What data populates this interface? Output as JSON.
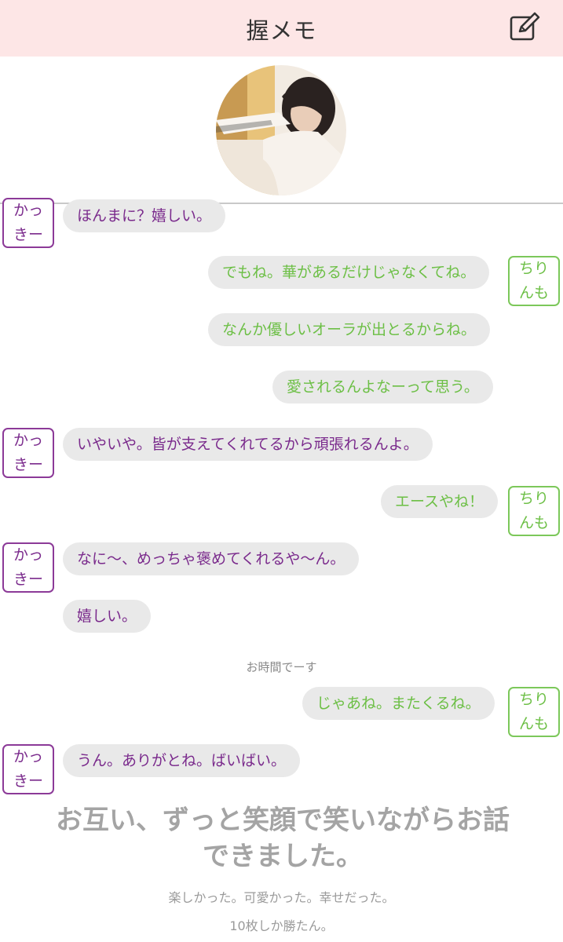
{
  "header": {
    "title": "握メモ",
    "edit_icon": "compose-icon"
  },
  "profile": {
    "avatar_description": "profile-photo"
  },
  "names": {
    "left": "かっきー",
    "right": "ちりんも"
  },
  "messages": [
    {
      "side": "left",
      "text": "ほんまに？嬉しい。"
    },
    {
      "side": "right",
      "text": "でもね。華があるだけじゃなくてね。"
    },
    {
      "side": "right",
      "text": "なんか優しいオーラが出とるからね。"
    },
    {
      "side": "right",
      "text": "愛されるんよなーって思う。"
    },
    {
      "side": "left",
      "text": "いやいや。皆が支えてくれてるから頑張れるんよ。"
    },
    {
      "side": "right",
      "text": "エースやね！"
    },
    {
      "side": "left",
      "text": "なに〜、めっちゃ褒めてくれるや〜ん。"
    },
    {
      "side": "left",
      "text": "嬉しい。"
    },
    {
      "side": "right",
      "text": "じゃあね。またくるね。"
    },
    {
      "side": "left",
      "text": "うん。ありがとね。ばいばい。"
    }
  ],
  "system_message": "お時間でーす",
  "summary": {
    "line1": "お互い、ずっと笑顔で笑いながらお話",
    "line2": "できました。",
    "sub1": "楽しかった。可愛かった。幸せだった。",
    "sub2": "10枚しか勝たん。"
  },
  "colors": {
    "header_bg": "#fde6e6",
    "left_accent": "#7a2a8c",
    "right_accent": "#6cbf45",
    "bubble_bg": "#e9e9e9"
  }
}
